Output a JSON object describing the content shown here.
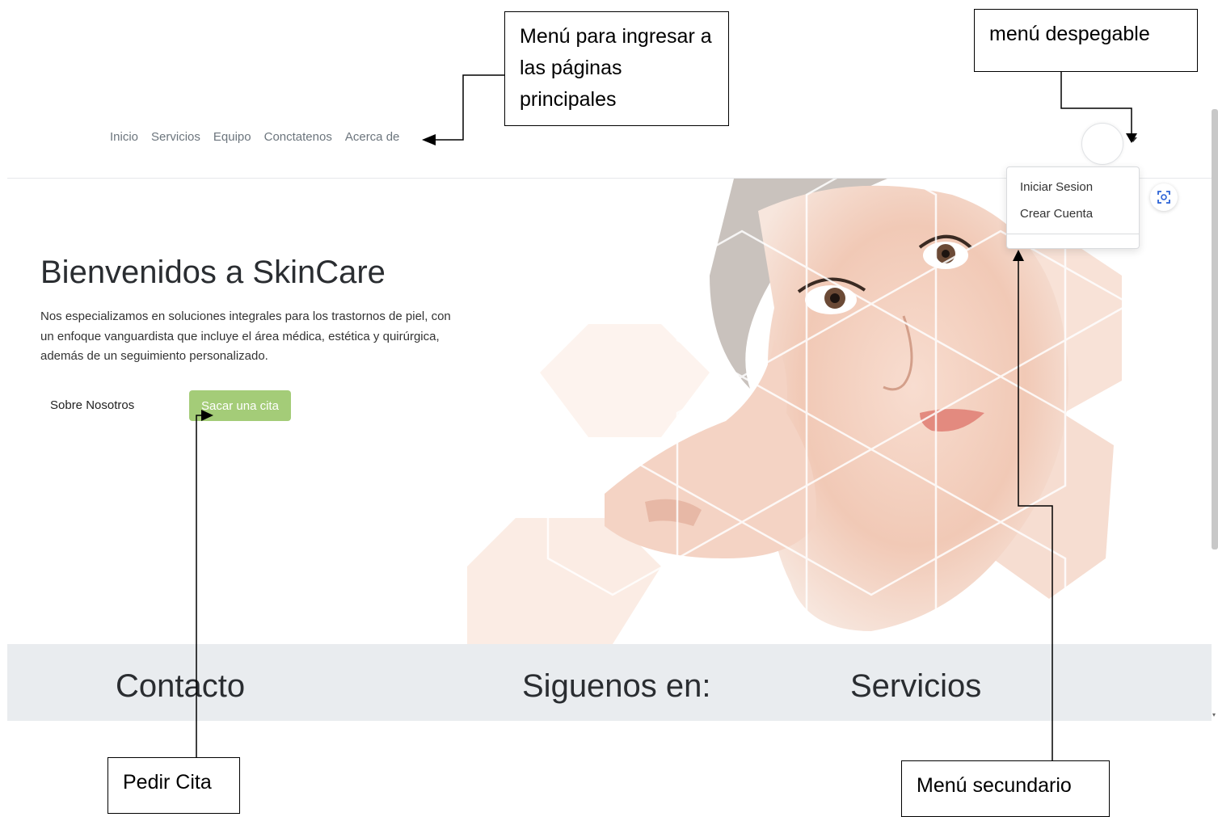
{
  "nav": {
    "links": [
      "Inicio",
      "Servicios",
      "Equipo",
      "Conctatenos",
      "Acerca de"
    ]
  },
  "user_menu": {
    "items": [
      "Iniciar Sesion",
      "Crear Cuenta"
    ]
  },
  "hero": {
    "title": "Bienvenidos a SkinCare",
    "text": "Nos especializamos en soluciones integrales para los trastornos de piel, con un enfoque vanguardista que incluye el área médica, estética y quirúrgica, además de un seguimiento personalizado.",
    "about_label": "Sobre Nosotros",
    "cita_label": "Sacar una cita"
  },
  "footer": {
    "contact": "Contacto",
    "follow": "Siguenos en:",
    "services": "Servicios"
  },
  "annotations": {
    "main_menu": "Menú para ingresar a las páginas principales",
    "dropdown": "menú despegable",
    "pedir_cita": "Pedir Cita",
    "secondary_menu": "Menú secundario"
  },
  "colors": {
    "accent_button": "#a4cc78",
    "footer_bg": "#e9ecef",
    "nav_text": "#6c757d"
  },
  "icons": [
    "user-avatar-icon",
    "caret-down-icon",
    "scan-icon",
    "arrow-icon"
  ]
}
